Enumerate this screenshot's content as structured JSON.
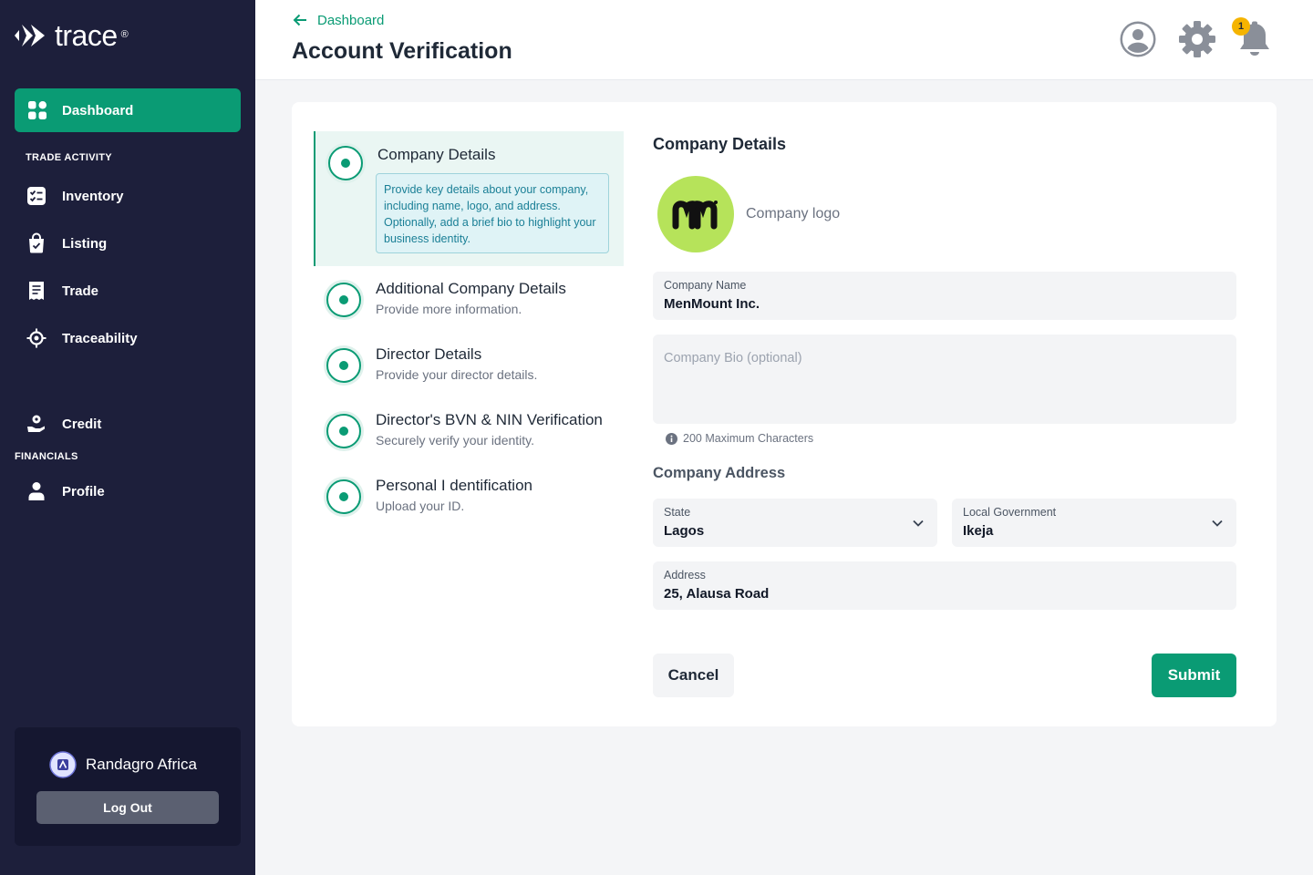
{
  "app": {
    "logo_text": "trace",
    "logo_mark": "®"
  },
  "sidebar": {
    "active_item": {
      "label": "Dashboard",
      "icon": "dashboard-grid-icon"
    },
    "sections": [
      {
        "label": "TRADE ACTIVITY"
      },
      {
        "label": "FINANCIALS"
      }
    ],
    "items": [
      {
        "label": "Inventory",
        "icon": "checklist-icon"
      },
      {
        "label": "Listing",
        "icon": "shopping-bag-icon"
      },
      {
        "label": "Trade",
        "icon": "receipt-icon"
      },
      {
        "label": "Traceability",
        "icon": "target-icon"
      },
      {
        "label": "Credit",
        "icon": "hand-coin-icon"
      },
      {
        "label": "Profile",
        "icon": "person-icon"
      }
    ],
    "account": {
      "name": "Randagro Africa",
      "logout_label": "Log Out"
    }
  },
  "header": {
    "back_label": "Dashboard",
    "title": "Account Verification",
    "notification_count": "1"
  },
  "steps": [
    {
      "title": "Company Details",
      "description": "Provide key details about your company, including name, logo, and address. Optionally, add a brief bio to highlight your business identity."
    },
    {
      "title": "Additional Company Details",
      "subtitle": "Provide more information."
    },
    {
      "title": "Director Details",
      "subtitle": "Provide your director details."
    },
    {
      "title": "Director's BVN & NIN Verification",
      "subtitle": "Securely verify your identity."
    },
    {
      "title": "Personal I dentification",
      "subtitle": "Upload your ID."
    }
  ],
  "form": {
    "title": "Company Details",
    "logo_label": "Company logo",
    "company_name": {
      "label": "Company Name",
      "value": "MenMount Inc."
    },
    "company_bio": {
      "placeholder": "Company Bio (optional)"
    },
    "bio_hint": "200 Maximum Characters",
    "address_section_title": "Company Address",
    "state": {
      "label": "State",
      "value": "Lagos"
    },
    "local_government": {
      "label": "Local Government",
      "value": "Ikeja"
    },
    "address": {
      "label": "Address",
      "value": "25, Alausa Road"
    },
    "cancel_label": "Cancel",
    "submit_label": "Submit"
  },
  "colors": {
    "sidebar_bg": "#1d1f3b",
    "accent": "#0a9b74",
    "logo_bg": "#b6e35a",
    "badge": "#f5b400"
  }
}
